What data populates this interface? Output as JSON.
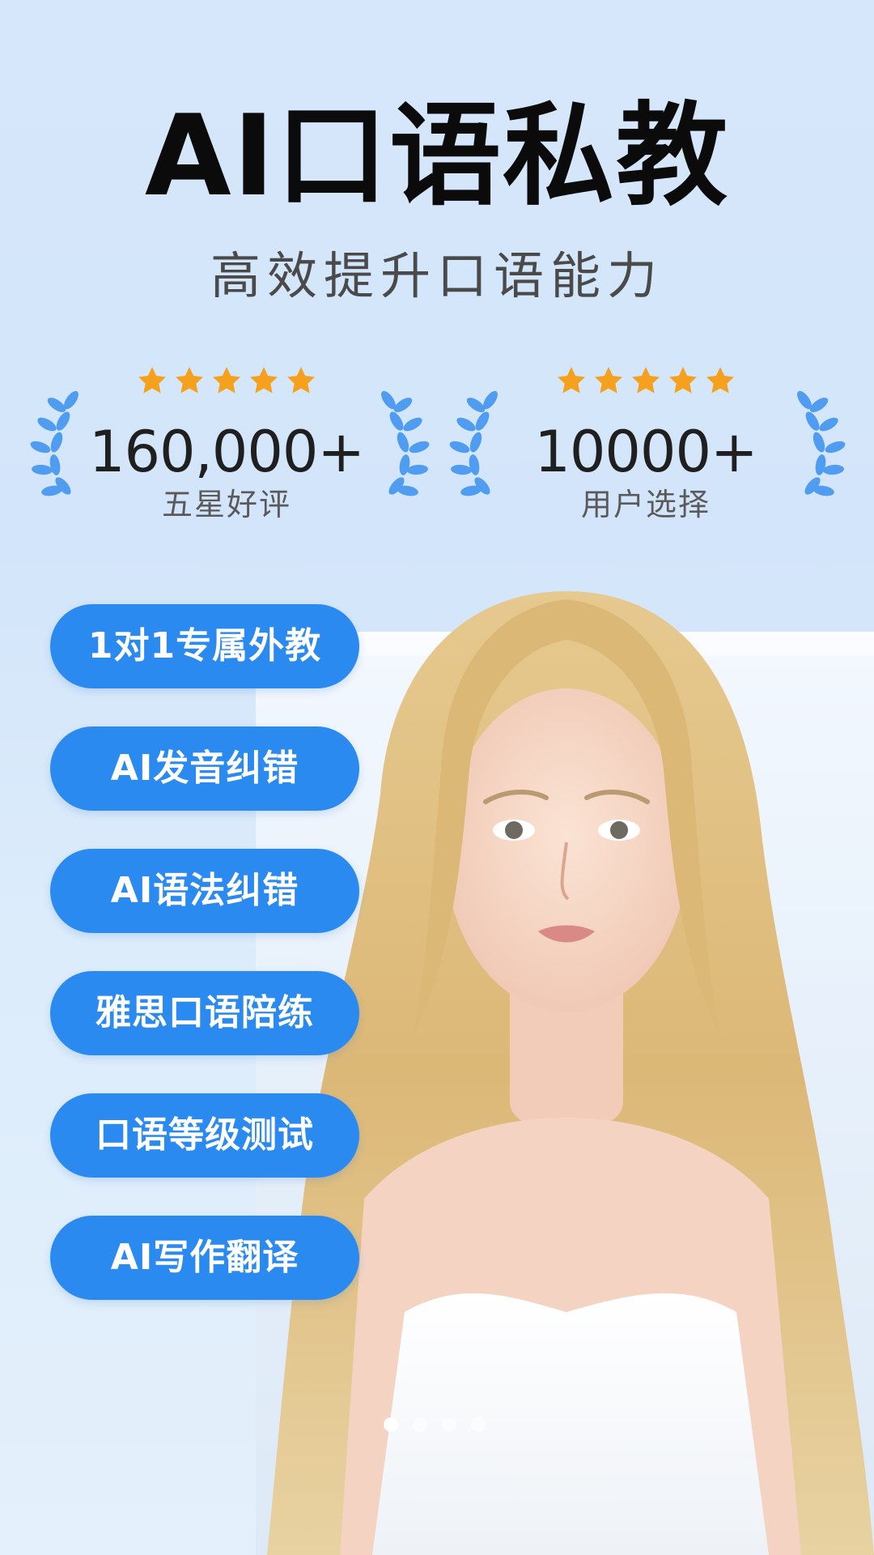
{
  "header": {
    "title": "AI口语私教",
    "subtitle": "高效提升口语能力"
  },
  "stats": [
    {
      "rating_stars": 5,
      "value": "160,000+",
      "label": "五星好评"
    },
    {
      "rating_stars": 5,
      "value": "10000+",
      "label": "用户选择"
    }
  ],
  "features": [
    {
      "label": "1对1专属外教"
    },
    {
      "label": "AI发音纠错"
    },
    {
      "label": "AI语法纠错"
    },
    {
      "label": "雅思口语陪练"
    },
    {
      "label": "口语等级测试"
    },
    {
      "label": "AI写作翻译"
    }
  ],
  "pager": {
    "total": 4,
    "active_index": 0
  },
  "colors": {
    "background": "#d6e7fb",
    "title": "#0b0b0b",
    "subtitle": "#4a4a4a",
    "star": "#f5a11e",
    "laurel": "#4f9cf0",
    "pill": "#2b8af0",
    "pill_text": "#ffffff"
  },
  "icons": {
    "rating": "star-icon",
    "decoration": "laurel-icon"
  }
}
